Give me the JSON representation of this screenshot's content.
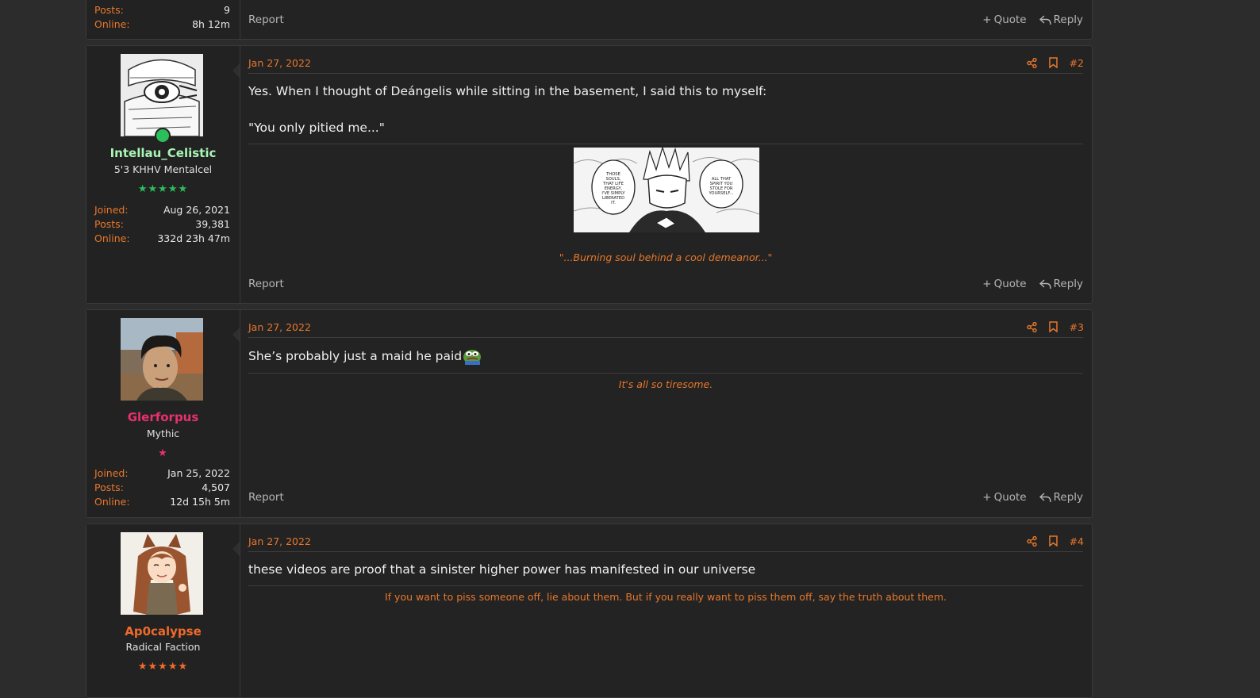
{
  "top_fragment": {
    "stats": [
      {
        "label": "Posts:",
        "value": "9"
      },
      {
        "label": "Online:",
        "value": "8h 12m"
      }
    ],
    "report_label": "Report",
    "quote_label": "Quote",
    "reply_label": "Reply"
  },
  "posts": [
    {
      "username": "Intellau_Celistic",
      "username_color": "#a8f5b4",
      "user_title": "5'3 KHHV Mentalcel",
      "stars": "★★★★★",
      "star_color": "#2bbf5b",
      "online": true,
      "stats": [
        {
          "label": "Joined:",
          "value": "Aug 26, 2021"
        },
        {
          "label": "Posts:",
          "value": "39,381"
        },
        {
          "label": "Online:",
          "value": "332d 23h 47m"
        }
      ],
      "date": "Jan 27, 2022",
      "number": "#2",
      "lines": [
        "Yes. When I thought of Deángelis while sitting in the basement, I said this to myself:",
        "\"You only pitied me...\""
      ],
      "manga_bubbles": [
        "THOSE SOULS, THAT LIFE ENERGY, I'VE SIMPLY LIBERATED IT.",
        "ALL THAT SPIRIT YOU STOLE FOR YOURSELF..."
      ],
      "signature": "\"...Burning soul behind a cool demeanor...\"",
      "report_label": "Report",
      "quote_label": "Quote",
      "reply_label": "Reply"
    },
    {
      "username": "Glerforpus",
      "username_color": "#e8306e",
      "user_title": "Mythic",
      "stars": "★",
      "star_color": "#e8306e",
      "online": false,
      "stats": [
        {
          "label": "Joined:",
          "value": "Jan 25, 2022"
        },
        {
          "label": "Posts:",
          "value": "4,507"
        },
        {
          "label": "Online:",
          "value": "12d 15h 5m"
        }
      ],
      "date": "Jan 27, 2022",
      "number": "#3",
      "lines": [
        "She’s probably just a maid he paid"
      ],
      "signature": "It's all so tiresome.",
      "report_label": "Report",
      "quote_label": "Quote",
      "reply_label": "Reply"
    },
    {
      "username": "Ap0calypse",
      "username_color": "#f06a2a",
      "user_title": "Radical Faction",
      "stars": "★★★★★",
      "star_color": "#f06a2a",
      "online": false,
      "date": "Jan 27, 2022",
      "number": "#4",
      "lines": [
        "these videos are proof that a sinister higher power has manifested in our universe"
      ],
      "signature": "If you want to piss someone off, lie about them. But if you really want to piss them off, say the truth about them."
    }
  ]
}
